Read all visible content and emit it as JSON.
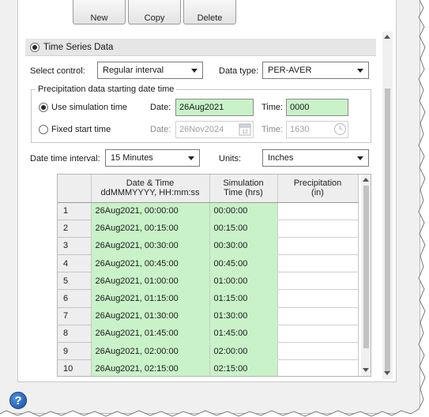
{
  "toolbar": {
    "new_label": "New",
    "copy_label": "Copy",
    "delete_label": "Delete"
  },
  "section": {
    "title": "Time Series Data"
  },
  "controls": {
    "select_control_label": "Select control:",
    "select_control_value": "Regular interval",
    "data_type_label": "Data type:",
    "data_type_value": "PER-AVER"
  },
  "start_group": {
    "legend": "Precipitation data starting date time",
    "use_sim_label": "Use simulation time",
    "fixed_label": "Fixed start time",
    "date_label": "Date:",
    "time_label": "Time:",
    "sim_date": "26Aug2021",
    "sim_time": "0000",
    "fixed_date": "26Nov2024",
    "fixed_time": "1630"
  },
  "interval": {
    "label": "Date time interval:",
    "value": "15 Minutes",
    "units_label": "Units:",
    "units_value": "Inches"
  },
  "grid": {
    "headers": {
      "datetime_line1": "Date & Time",
      "datetime_line2": "ddMMMYYYY, HH:mm:ss",
      "sim_line1": "Simulation",
      "sim_line2": "Time (hrs)",
      "precip_line1": "Precipitation",
      "precip_line2": "(in)"
    },
    "rows": [
      {
        "n": "1",
        "dt": "26Aug2021, 00:00:00",
        "sim": "00:00:00",
        "p": ""
      },
      {
        "n": "2",
        "dt": "26Aug2021, 00:15:00",
        "sim": "00:15:00",
        "p": ""
      },
      {
        "n": "3",
        "dt": "26Aug2021, 00:30:00",
        "sim": "00:30:00",
        "p": ""
      },
      {
        "n": "4",
        "dt": "26Aug2021, 00:45:00",
        "sim": "00:45:00",
        "p": ""
      },
      {
        "n": "5",
        "dt": "26Aug2021, 01:00:00",
        "sim": "01:00:00",
        "p": ""
      },
      {
        "n": "6",
        "dt": "26Aug2021, 01:15:00",
        "sim": "01:15:00",
        "p": ""
      },
      {
        "n": "7",
        "dt": "26Aug2021, 01:30:00",
        "sim": "01:30:00",
        "p": ""
      },
      {
        "n": "8",
        "dt": "26Aug2021, 01:45:00",
        "sim": "01:45:00",
        "p": ""
      },
      {
        "n": "9",
        "dt": "26Aug2021, 02:00:00",
        "sim": "02:00:00",
        "p": ""
      },
      {
        "n": "10",
        "dt": "26Aug2021, 02:15:00",
        "sim": "02:15:00",
        "p": ""
      }
    ]
  },
  "help": {
    "symbol": "?"
  },
  "colors": {
    "input_green": "#c9f2c9",
    "header_gray": "#e6e6e6",
    "help_blue": "#1a4fa8"
  },
  "icons": {
    "calendar": "calendar-icon",
    "clock": "clock-icon",
    "help": "help-icon"
  }
}
